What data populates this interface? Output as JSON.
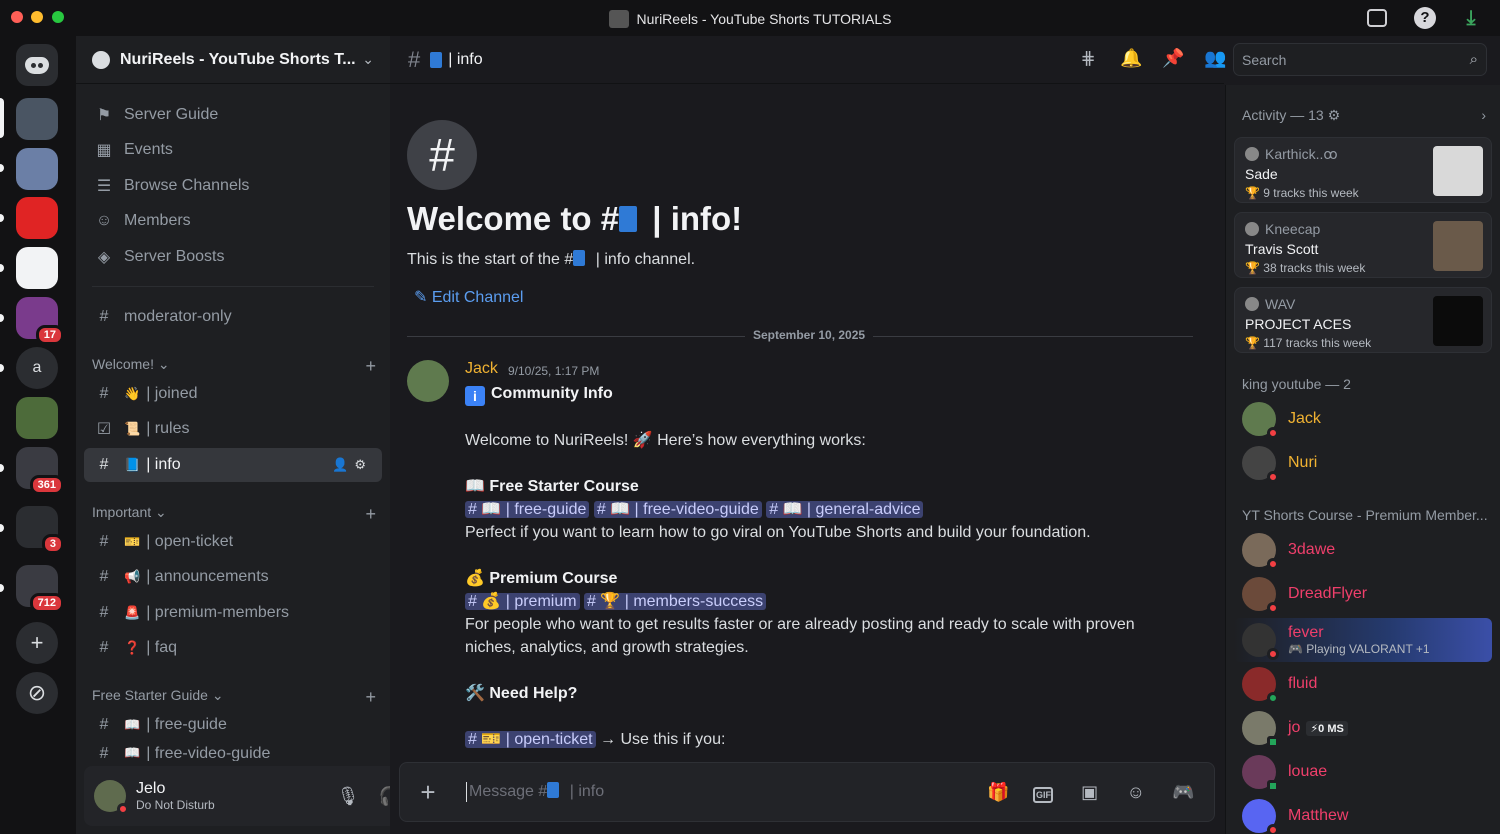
{
  "window": {
    "title": "NuriReels - YouTube Shorts TUTORIALS"
  },
  "rail": {
    "badges": {
      "s5": "17",
      "s8": "361",
      "s9": "3",
      "s10": "712"
    },
    "letter_server": "a"
  },
  "server": {
    "name": "NuriReels - YouTube Shorts T..."
  },
  "nav": {
    "server_guide": "Server Guide",
    "events": "Events",
    "browse_channels": "Browse Channels",
    "members": "Members",
    "server_boosts": "Server Boosts",
    "moderator_only": "moderator-only"
  },
  "categories": {
    "welcome": "Welcome!",
    "important": "Important",
    "free_starter_guide": "Free Starter Guide"
  },
  "channels": {
    "joined": "| joined",
    "rules": "| rules",
    "info": "| info",
    "open_ticket": "| open-ticket",
    "announcements": "| announcements",
    "premium_members": "| premium-members",
    "faq": "| faq",
    "free_guide": "| free-guide",
    "free_video_guide": "| free-video-guide"
  },
  "user": {
    "name": "Jelo",
    "status": "Do Not Disturb"
  },
  "header": {
    "channel_title": "| info"
  },
  "welcome": {
    "title_prefix": "Welcome to #",
    "title_suffix": " | info!",
    "sub_prefix": "This is the start of the #",
    "sub_suffix": " | info channel.",
    "edit": "Edit Channel"
  },
  "date_divider": "September 10, 2025",
  "message": {
    "author": "Jack",
    "time": "9/10/25, 1:17 PM",
    "heading": "Community Info",
    "intro": "Welcome to NuriReels! 🚀 Here’s how everything works:",
    "free_title": "📖 Free Starter Course",
    "free_mentions": [
      "# 📖 | free-guide",
      "# 📖 | free-video-guide",
      "# 📖 | general-advice"
    ],
    "free_desc": "Perfect if you want to learn how to go viral on YouTube Shorts and build your foundation.",
    "premium_title": "💰 Premium Course",
    "premium_mentions": [
      "# 💰 | premium",
      "# 🏆 | members-success"
    ],
    "premium_desc": "For people who want to get results faster or are already posting and ready to scale with proven niches, analytics, and growth strategies.",
    "help_title": "🛠️ Need Help?",
    "help_mention": "# 🎫 | open-ticket",
    "help_tail": "→ Use this if you:"
  },
  "composer": {
    "placeholder_prefix": "Message #",
    "placeholder_suffix": " | info"
  },
  "search": {
    "placeholder": "Search"
  },
  "activity": {
    "heading": "Activity — 13",
    "cards": [
      {
        "user": "Karthick..ꝏ",
        "artist": "Sade",
        "count": "9 tracks this week"
      },
      {
        "user": "Kneecap",
        "artist": "Travis Scott",
        "count": "38 tracks this week"
      },
      {
        "user": "WAV",
        "artist": "PROJECT ACES",
        "count": "117 tracks this week"
      }
    ]
  },
  "groups": {
    "king": "king youtube — 2",
    "premium": "YT Shorts Course - Premium Member..."
  },
  "members": {
    "jack": "Jack",
    "nuri": "Nuri",
    "threedawe": "3dawe",
    "dreadflyer": "DreadFlyer",
    "fever": "fever",
    "fever_activity": "Playing VALORANT +1",
    "fluid": "fluid",
    "jo": "jo",
    "jo_tag": "⚡0 MS",
    "louae": "louae",
    "matthew": "Matthew"
  },
  "colors": {
    "accent_mention_bg": "#3c4270",
    "jack": "#f0b232",
    "premium_pink": "#ef3f6b",
    "link_blue": "#5b9df0",
    "dnd_red": "#f23f43",
    "online_green": "#23a55a"
  }
}
